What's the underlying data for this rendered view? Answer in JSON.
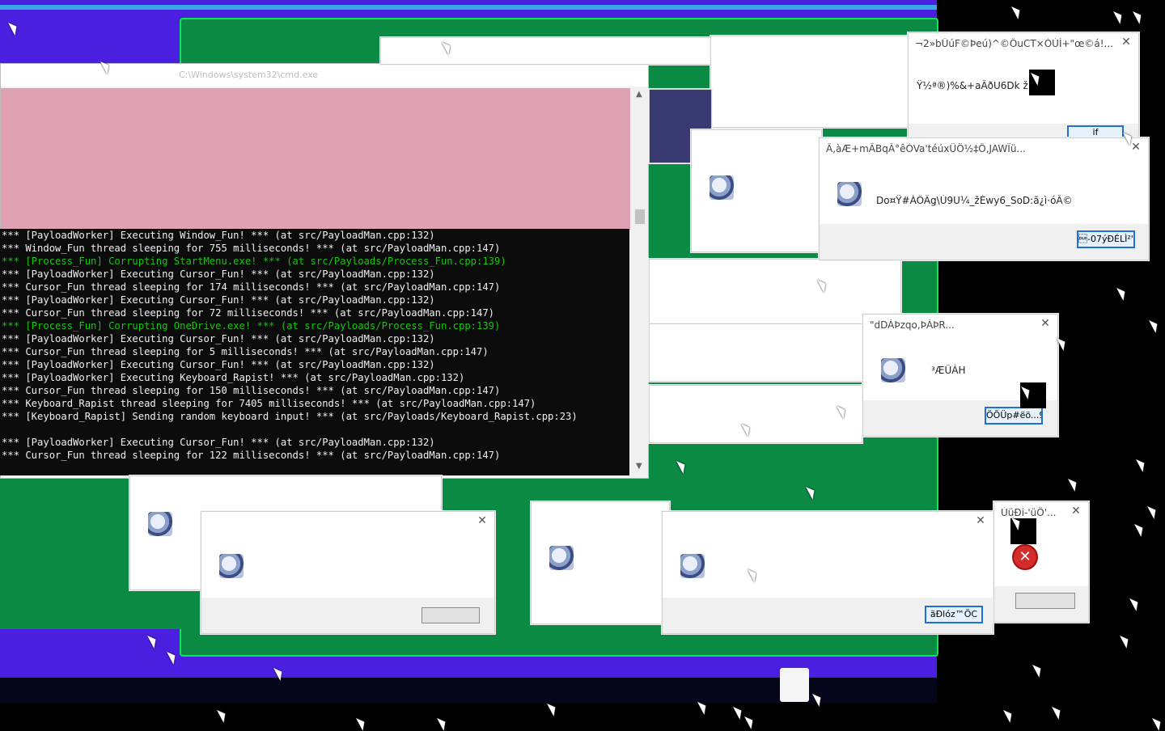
{
  "console": {
    "window_title": "C:\\Windows\\system32\\cmd.exe",
    "lines": [
      {
        "text": "*** [PayloadWorker] Executing Window_Fun! *** (at src/PayloadMan.cpp:132)",
        "style": "y"
      },
      {
        "text": "*** Window_Fun thread sleeping for 755 milliseconds! *** (at src/PayloadMan.cpp:147)",
        "style": "y"
      },
      {
        "text": "*** [Process_Fun] Corrupting StartMenu.exe! *** (at src/Payloads/Process_Fun.cpp:139)",
        "style": "g"
      },
      {
        "text": "*** [PayloadWorker] Executing Cursor_Fun! *** (at src/PayloadMan.cpp:132)",
        "style": "y"
      },
      {
        "text": "*** Cursor_Fun thread sleeping for 174 milliseconds! *** (at src/PayloadMan.cpp:147)",
        "style": "y"
      },
      {
        "text": "*** [PayloadWorker] Executing Cursor_Fun! *** (at src/PayloadMan.cpp:132)",
        "style": "y"
      },
      {
        "text": "*** Cursor_Fun thread sleeping for 72 milliseconds! *** (at src/PayloadMan.cpp:147)",
        "style": "y"
      },
      {
        "text": "*** [Process_Fun] Corrupting OneDrive.exe! *** (at src/Payloads/Process_Fun.cpp:139)",
        "style": "g"
      },
      {
        "text": "*** [PayloadWorker] Executing Cursor_Fun! *** (at src/PayloadMan.cpp:132)",
        "style": "y"
      },
      {
        "text": "*** Cursor_Fun thread sleeping for 5 milliseconds! *** (at src/PayloadMan.cpp:147)",
        "style": "y"
      },
      {
        "text": "*** [PayloadWorker] Executing Cursor_Fun! *** (at src/PayloadMan.cpp:132)",
        "style": "y"
      },
      {
        "text": "*** [PayloadWorker] Executing Keyboard_Rapist! *** (at src/PayloadMan.cpp:132)",
        "style": "y"
      },
      {
        "text": "*** Cursor_Fun thread sleeping for 150 milliseconds! *** (at src/PayloadMan.cpp:147)",
        "style": "y"
      },
      {
        "text": "*** Keyboard_Rapist thread sleeping for 7405 milliseconds! *** (at src/PayloadMan.cpp:147)",
        "style": "y"
      },
      {
        "text": "*** [Keyboard_Rapist] Sending random keyboard input! *** (at src/Payloads/Keyboard_Rapist.cpp:23)",
        "style": "y"
      },
      {
        "text": "",
        "style": "y"
      },
      {
        "text": "*** [PayloadWorker] Executing Cursor_Fun! *** (at src/PayloadMan.cpp:132)",
        "style": "y"
      },
      {
        "text": "*** Cursor_Fun thread sleeping for 122 milliseconds! *** (at src/PayloadMan.cpp:147)",
        "style": "y"
      }
    ]
  },
  "dialogs": {
    "d1": {
      "title": "¬2»bÛúF©Þeú)^©ÔuCT×ÒÙÍ+\"œ©á!...",
      "body": "Ÿ½ª®)%&+aÂðU6Dk ž",
      "button": "if"
    },
    "d2": {
      "title": "Ä,àÆ+mÃBqÂ°êÒVa'téúxÜÖ½‡Ö,JAWÏü...",
      "body": "Do¤Ÿ#ÁÔÄg\\Ù9U¼_žÈwy6_SoD:ã¿ì·óÂ©",
      "button": "\u0010-07ýÐÉLÌ²'("
    },
    "d3": {
      "title": "\"dDÁÞzqo,ÞÁÞR...",
      "body": "³ÆÜÁH",
      "button": "ÖÕÜp#ëö...9"
    },
    "d4": {
      "title": "ÙüÐi-'üÖ'...",
      "body": "",
      "button": ""
    },
    "d5": {
      "title": "",
      "body": "",
      "button": "äÐlóz™ÖC"
    },
    "d6": {
      "title": "",
      "body": "",
      "button": ""
    }
  },
  "icons": {
    "system_icon": "system-info-icon",
    "error_icon": "error-icon",
    "cursor": "mouse-pointer-icon",
    "close": "close-icon",
    "file": "document-file-icon"
  },
  "colors": {
    "desktop_blue": "#4b1fe0",
    "desktop_green": "#0a8a43",
    "console_bg": "#0c0c0c",
    "console_green": "#16c60c",
    "pink_pane": "#e0a1b5"
  }
}
